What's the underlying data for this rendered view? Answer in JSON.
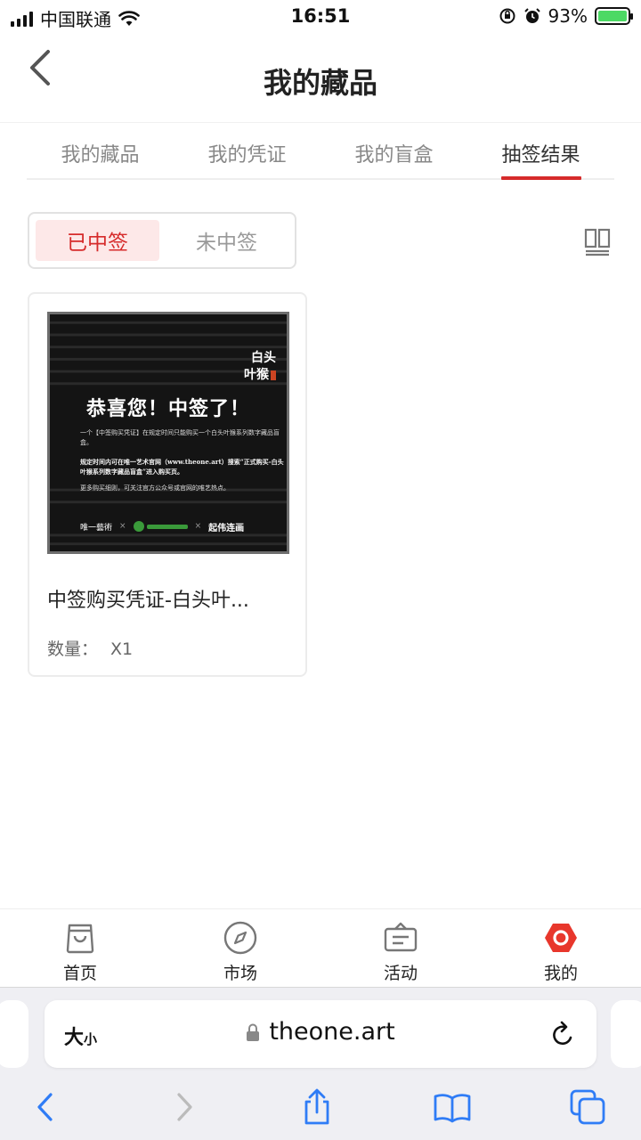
{
  "status_bar": {
    "carrier": "中国联通",
    "time": "16:51",
    "battery": "93%"
  },
  "header": {
    "title": "我的藏品"
  },
  "tabs": [
    {
      "label": "我的藏品",
      "active": false
    },
    {
      "label": "我的凭证",
      "active": false
    },
    {
      "label": "我的盲盒",
      "active": false
    },
    {
      "label": "抽签结果",
      "active": true
    }
  ],
  "filter": {
    "won": "已中签",
    "not_won": "未中签",
    "selected": "won"
  },
  "card": {
    "title": "中签购买凭证-白头叶...",
    "qty_label": "数量：",
    "qty_value": "X1",
    "poster": {
      "tag_line1": "白头",
      "tag_line2": "叶猴",
      "headline": "恭喜您！中签了！",
      "body1": "一个【中签购买凭证】在规定时间只能购买一个白头叶猴系列数字藏品盲盒。",
      "body2": "规定时间内可在唯一艺术官网（www.theone.art）搜索“正式购买-白头叶猴系列数字藏品盲盒”进入购买页。",
      "body3": "更多购买细则，可关注官方公众号或官网的唯艺热点。",
      "footer_left": "唯一藝術",
      "footer_sep": "×",
      "footer_right": "起伟连画"
    }
  },
  "bottom_nav": [
    {
      "label": "首页",
      "icon": "shopping-bag-icon"
    },
    {
      "label": "市场",
      "icon": "compass-icon"
    },
    {
      "label": "活动",
      "icon": "ticket-icon"
    },
    {
      "label": "我的",
      "icon": "profile-hexagon-icon",
      "active": true
    }
  ],
  "browser": {
    "text_size": "大",
    "text_size_small": "小",
    "url": "theone.art"
  },
  "colors": {
    "accent": "#d62b2b",
    "accent_bg": "#fde8e8",
    "tab_inactive": "#888888"
  }
}
